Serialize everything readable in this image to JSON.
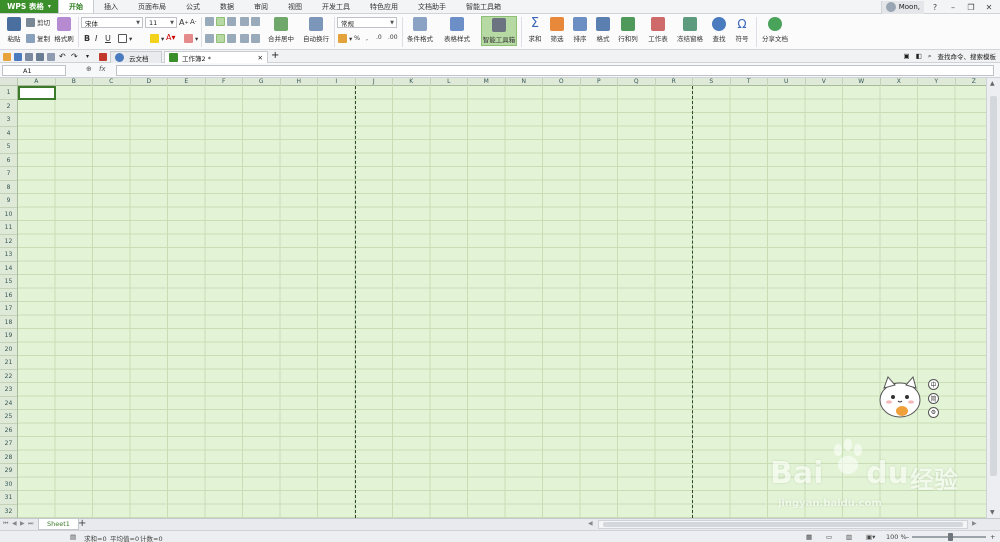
{
  "app": {
    "name": "WPS 表格"
  },
  "menu": {
    "tabs": [
      "开始",
      "插入",
      "页面布局",
      "公式",
      "数据",
      "审阅",
      "视图",
      "开发工具",
      "特色应用",
      "文档助手",
      "智能工具箱"
    ],
    "active": "开始"
  },
  "titlebar": {
    "user": "Moon,"
  },
  "ribbon": {
    "paste": "粘贴",
    "cut": "剪切",
    "copy": "复制",
    "format_painter": "格式刷",
    "font_name": "宋体",
    "font_size": "11",
    "bold": "B",
    "italic": "I",
    "underline": "U",
    "merge_center": "合并居中",
    "wrap_text": "自动换行",
    "number_format": "常规",
    "percent": "%",
    "conditional_format": "条件格式",
    "table_style": "表格样式",
    "smart_toolbox": "智能工具箱",
    "sum": "求和",
    "filter": "筛选",
    "sort": "排序",
    "format": "格式",
    "row_col": "行和列",
    "worksheet": "工作表",
    "freeze": "冻结窗格",
    "find": "查找",
    "symbol": "符号",
    "share": "分享文档"
  },
  "doc_tabs": {
    "cloud": "云文档",
    "workbook": "工作簿2 *"
  },
  "search": {
    "placeholder": "查找命令、搜索模板"
  },
  "formula_bar": {
    "cell_ref": "A1",
    "fx": "fx"
  },
  "columns": [
    "A",
    "B",
    "C",
    "D",
    "E",
    "F",
    "G",
    "H",
    "I",
    "J",
    "K",
    "L",
    "M",
    "N",
    "O",
    "P",
    "Q",
    "R",
    "S",
    "T",
    "U",
    "V",
    "W",
    "X",
    "Y",
    "Z"
  ],
  "rows": [
    "1",
    "2",
    "3",
    "4",
    "5",
    "6",
    "7",
    "8",
    "9",
    "10",
    "11",
    "12",
    "13",
    "14",
    "15",
    "16",
    "17",
    "18",
    "19",
    "20",
    "21",
    "22",
    "23",
    "24",
    "25",
    "26",
    "27",
    "28",
    "29",
    "30",
    "31",
    "32"
  ],
  "sheets": {
    "active": "Sheet1"
  },
  "status": {
    "sum": "求和=0",
    "average": "平均值=0",
    "count": "计数=0",
    "zoom": "100 %",
    "zoom_level": 100
  },
  "side_buttons": [
    "中",
    "简",
    "⚙"
  ],
  "watermark": {
    "brand": "Bai",
    "brand2": "du",
    "cn": "经验",
    "url": "jingyan.baidu.com"
  },
  "colors": {
    "accent": "#3b8f2a",
    "grid_bg": "#e3f4d6",
    "grid_line": "#c8ddb6"
  }
}
